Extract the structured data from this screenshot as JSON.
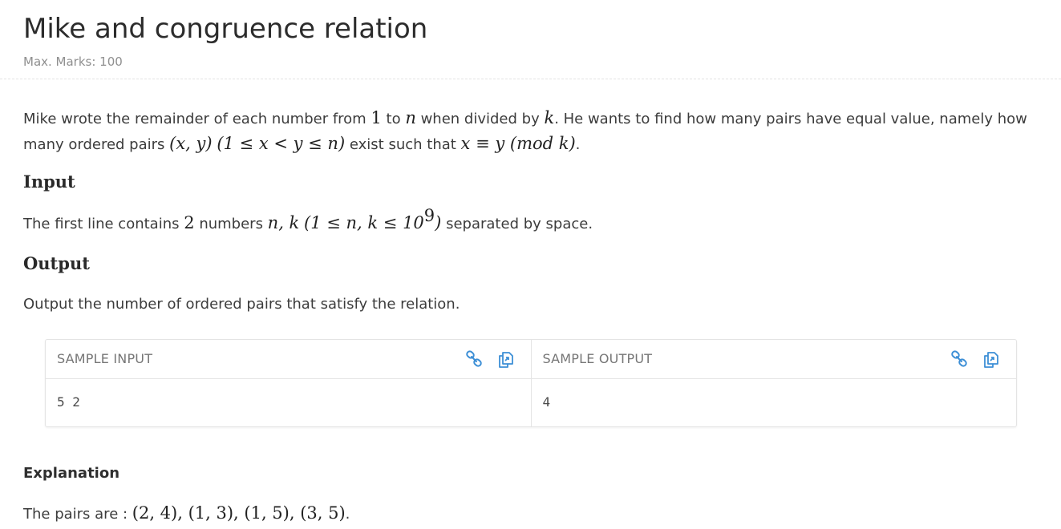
{
  "problem": {
    "title": "Mike and congruence relation",
    "marks": "Max. Marks: 100"
  },
  "statement": {
    "t1": "Mike wrote the remainder of each number from ",
    "m1": "1",
    "t2": " to ",
    "m2": "n",
    "t3": " when divided by ",
    "m3": "k",
    "t4": ". He wants to find how many pairs have equal value, namely how many ordered pairs ",
    "m4": "(x, y)",
    "t5": " ",
    "m5": "(1 ≤ x < y ≤ n)",
    "t6": " exist such that ",
    "m6": "x ≡ y (mod k)",
    "t7": "."
  },
  "input": {
    "heading": "Input",
    "t1": "The first line contains ",
    "m1": "2",
    "t2": " numbers ",
    "m2": "n, k",
    "t3": " ",
    "m3_open": "(1 ≤ n, k ≤ 10",
    "m3_exp": "9",
    "m3_close": ")",
    "t4": " separated by space."
  },
  "output": {
    "heading": "Output",
    "text": "Output the number of ordered pairs that satisfy the relation."
  },
  "samples": {
    "input_title": "SAMPLE INPUT",
    "input_value": "5 2",
    "output_title": "SAMPLE OUTPUT",
    "output_value": "4",
    "link_icon": "link-icon",
    "copy_icon": "copy-icon",
    "icon_color": "#3d8fd6"
  },
  "explanation": {
    "heading": "Explanation",
    "prefix": "The pairs are : ",
    "pairs": "(2, 4), (1, 3), (1, 5), (3, 5)",
    "suffix": "."
  }
}
